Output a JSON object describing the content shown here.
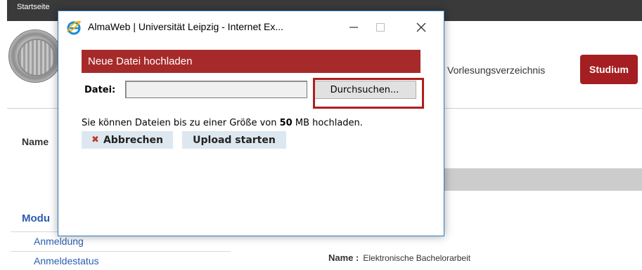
{
  "background": {
    "topbar_text": "Startseite",
    "nav": {
      "vorlesungsverzeichnis": "Vorlesungsverzeichnis",
      "studium": "Studium"
    },
    "name_label": "Name",
    "sidebar": {
      "section_title": "Modu",
      "items": [
        "Anmeldung",
        "Anmeldestatus"
      ]
    },
    "detail": {
      "name_label": "Name :",
      "name_value": "Elektronische Bachelorarbeit"
    },
    "colors": {
      "brand_red": "#a51e22",
      "link_blue": "#2a5db0"
    }
  },
  "dialog": {
    "window_title": "AlmaWeb | Universität Leipzig - Internet Ex...",
    "icons": {
      "app": "internet-explorer-icon",
      "minimize": "minimize-icon",
      "maximize": "maximize-icon",
      "close": "close-icon"
    },
    "header": "Neue Datei hochladen",
    "file_label": "Datei:",
    "file_value": "",
    "browse_label": "Durchsuchen...",
    "info": {
      "prefix": "Sie können Dateien bis zu einer Größe von",
      "size": "50",
      "suffix": "MB hochladen."
    },
    "cancel_label": "Abbrechen",
    "upload_label": "Upload starten",
    "colors": {
      "header_bg": "#a72a2a",
      "highlight": "#b01e1e",
      "button_bg": "#dde7ef"
    }
  }
}
